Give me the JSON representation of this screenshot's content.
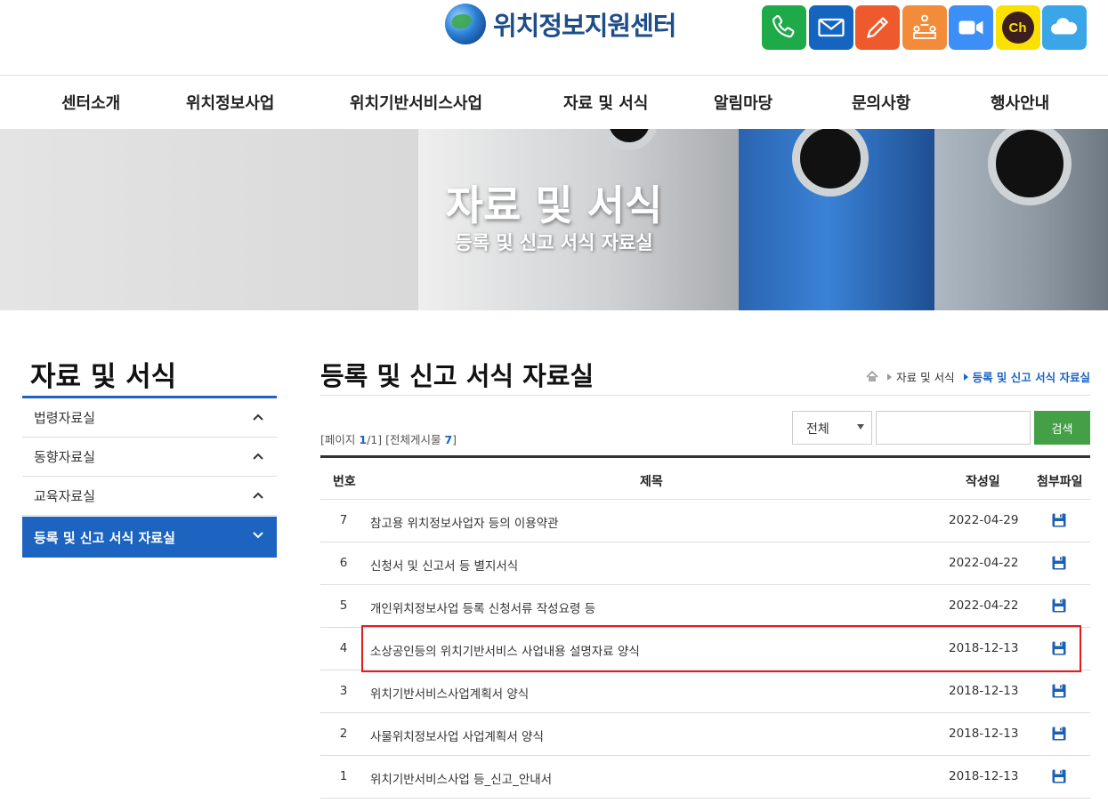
{
  "header": {
    "logo_text": "위치정보지원센터",
    "quick_links": [
      {
        "icon": "phone-icon",
        "color": "#1faa4a"
      },
      {
        "icon": "mail-icon",
        "color": "#1565c0"
      },
      {
        "icon": "pencil-icon",
        "color": "#ef5a2c"
      },
      {
        "icon": "meeting-icon",
        "color": "#f28c3a"
      },
      {
        "icon": "video-icon",
        "color": "#3b8ff5"
      },
      {
        "icon": "kakao-channel-icon",
        "color": "#fae100",
        "label": "Ch"
      },
      {
        "icon": "cloud-icon",
        "color": "#3aa6e8"
      }
    ]
  },
  "nav": {
    "items": [
      "센터소개",
      "위치정보사업",
      "위치기반서비스사업",
      "자료 및 서식",
      "알림마당",
      "문의사항",
      "행사안내"
    ]
  },
  "banner": {
    "title": "자료 및 서식",
    "subtitle": "등록 및 신고 서식 자료실"
  },
  "sidebar": {
    "title": "자료 및 서식",
    "items": [
      {
        "label": "법령자료실"
      },
      {
        "label": "동향자료실"
      },
      {
        "label": "교육자료실"
      },
      {
        "label": "등록 및 신고 서식 자료실"
      }
    ]
  },
  "main": {
    "title": "등록 및 신고 서식 자료실",
    "breadcrumb": [
      "자료 및 서식",
      "등록 및 신고 서식 자료실"
    ],
    "pageinfo": {
      "page_prefix": "[페이지 ",
      "page_current": "1",
      "page_rest": "/1]",
      "total_prefix": "[전체게시물 ",
      "total_count": "7",
      "total_suffix": "]"
    },
    "search": {
      "select_value": "전체",
      "input_value": "",
      "button_label": "검색"
    },
    "table": {
      "headers": [
        "번호",
        "제목",
        "작성일",
        "첨부파일"
      ],
      "rows": [
        {
          "num": "7",
          "title": "참고용 위치정보사업자 등의 이용약관",
          "date": "2022-04-29"
        },
        {
          "num": "6",
          "title": "신청서 및 신고서 등 별지서식",
          "date": "2022-04-22"
        },
        {
          "num": "5",
          "title": "개인위치정보사업 등록 신청서류 작성요령 등",
          "date": "2022-04-22"
        },
        {
          "num": "4",
          "title": "소상공인등의 위치기반서비스 사업내용 설명자료 양식",
          "date": "2018-12-13"
        },
        {
          "num": "3",
          "title": "위치기반서비스사업계획서 양식",
          "date": "2018-12-13"
        },
        {
          "num": "2",
          "title": "사물위치정보사업 사업계획서 양식",
          "date": "2018-12-13"
        },
        {
          "num": "1",
          "title": "위치기반서비스사업 등_신고_안내서",
          "date": "2018-12-13"
        }
      ]
    }
  },
  "colors": {
    "accent": "#1c64c0",
    "search_button": "#43a047",
    "highlight": "#e31b1b"
  }
}
